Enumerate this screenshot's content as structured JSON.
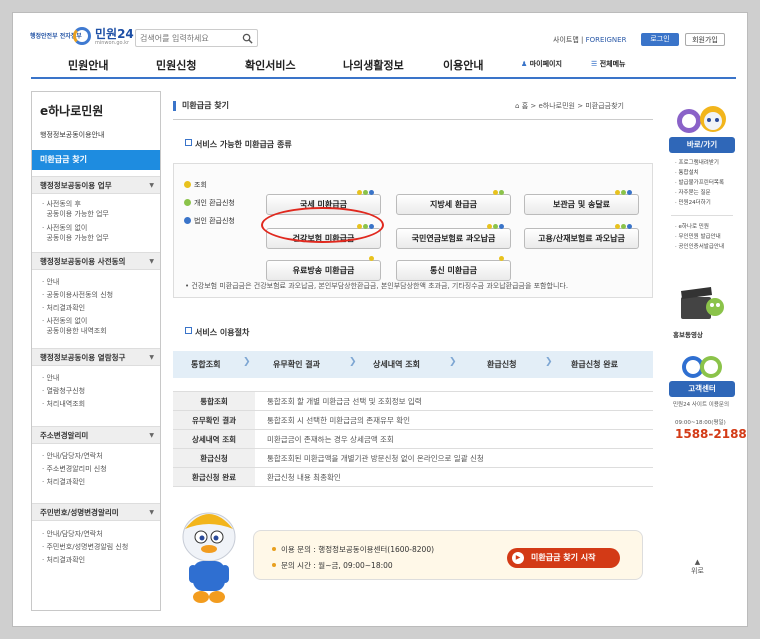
{
  "header": {
    "gov_logo": "행정안전부 전자정부",
    "logo_name": "민원24",
    "logo_url": "minwon.go.kr",
    "search_placeholder": "검색어를 입력하세요",
    "sitemap": "사이트맵",
    "foreigner": "FOREIGNER",
    "login": "로그인",
    "join": "회원가입"
  },
  "gnb": {
    "items": [
      "민원안내",
      "민원신청",
      "확인서비스",
      "나의생활정보",
      "이용안내"
    ],
    "mypage": "마이페이지",
    "allmenu": "전체메뉴"
  },
  "sidebar": {
    "title": "e하나로민원",
    "subtitle": "행정정보공동이용안내",
    "active": "미환급금 찾기",
    "sections": [
      {
        "title": "행정정보공동이용 업무",
        "items": [
          "사전동의 후",
          "공동이용 가능한 업무",
          "사전동의 없이",
          "공동이용 가능한 업무"
        ]
      },
      {
        "title": "행정정보공동이용 사전동의",
        "items": [
          "안내",
          "공동이용사전동의 신청",
          "처리결과확인",
          "사전동의 없이",
          "공동이용한 내역조회"
        ]
      },
      {
        "title": "행정정보공동이용 열람청구",
        "items": [
          "안내",
          "열람청구신청",
          "처리내역조회"
        ]
      },
      {
        "title": "주소변경알리미",
        "items": [
          "안내/담당자/연락처",
          "주소변경알리미 신청",
          "처리결과확인"
        ]
      },
      {
        "title": "주민번호/성명변경알리미",
        "items": [
          "안내/담당자/연락처",
          "주민번호/성명변경알림 신청",
          "처리결과확인"
        ]
      }
    ]
  },
  "main": {
    "page_title": "미환급금 찾기",
    "breadcrumb": [
      "홈",
      "e하나로민원",
      "미환급금찾기"
    ],
    "services_title": "서비스 가능한 미환급금 종류",
    "legend": [
      {
        "label": "조회",
        "color": "#e8c21e"
      },
      {
        "label": "개인 환급신청",
        "color": "#8bc34a"
      },
      {
        "label": "법인 환급신청",
        "color": "#3a74c9"
      }
    ],
    "services": [
      "국세 미환급금",
      "지방세 환급금",
      "보관금 및 송달료",
      "건강보험 미환급금",
      "국민연금보험료 과오납금",
      "고용/산재보험료 과오납금",
      "유료방송 미환급금",
      "통신 미환급금"
    ],
    "note": "건강보험 미환급금은 건강보험료 과오납금, 본인부담상한환급금, 본인부담상한액 초과금, 기타징수금 과오납환급금을 포함합니다.",
    "process_title": "서비스 이용절차",
    "steps": [
      "통합조회",
      "유무확인 결과",
      "상세내역 조회",
      "환급신청",
      "환급신청 완료"
    ],
    "table": [
      {
        "h": "통합조회",
        "d": "통합조회 할 개별 미환급금 선택 및 조회정보 입력"
      },
      {
        "h": "유무확인 결과",
        "d": "통합조회 시 선택한 미환급금의 존재유무 확인"
      },
      {
        "h": "상세내역 조회",
        "d": "미환급금이 존재하는 경우 상세금액 조회"
      },
      {
        "h": "환급신청",
        "d": "통합조회된 미환급액을 개별기관 방문신청 없이 온라인으로 일괄 신청"
      },
      {
        "h": "환급신청 완료",
        "d": "환급신청 내용 최종확인"
      }
    ],
    "contact_label1": "이용 문의 :",
    "contact_value1": "행정정보공동이용센터(1600-8200)",
    "contact_label2": "문의 시간 :",
    "contact_value2": "월~금, 09:00~18:00",
    "start_button": "미환급금 찾기 시작"
  },
  "quick": {
    "title": "바로/가기",
    "links1": [
      "프로그램내려받기",
      "통합설치",
      "발급불가프린터목록",
      "자주묻는 질문",
      "민원24더하기"
    ],
    "links2": [
      "e하나로 민원",
      "무인민원 발급안내",
      "공인인증서발급안내"
    ],
    "video": "홍보동영상",
    "cs_title": "고객센터",
    "cs_sub": "민원24 사이트 이용문의",
    "cs_hours": "09:00~18:00(평일)",
    "cs_phone": "1588-2188",
    "top": "위로"
  }
}
